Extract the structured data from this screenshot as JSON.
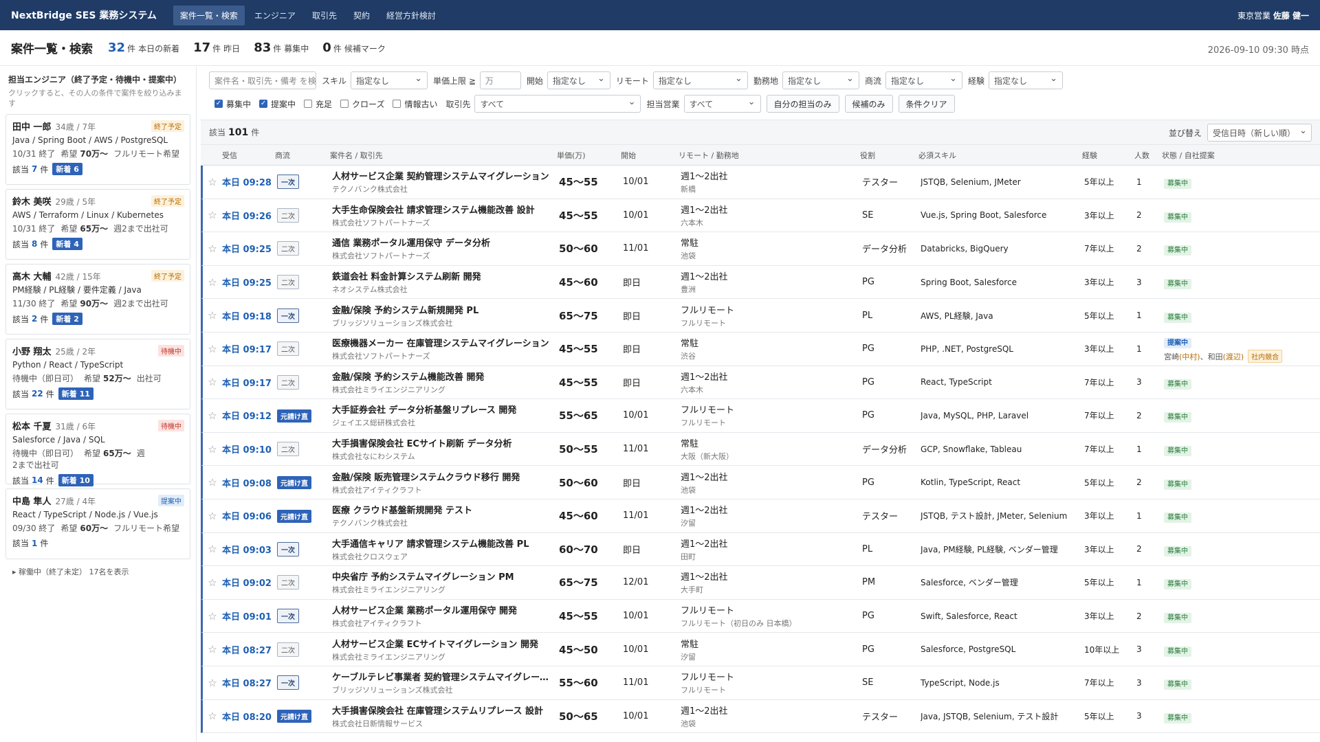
{
  "app": {
    "brand": "NextBridge SES 業務システム",
    "user_dept": "東京営業",
    "user_name": "佐藤 健一"
  },
  "nav": [
    {
      "label": "案件一覧・検索",
      "active": true
    },
    {
      "label": "エンジニア",
      "active": false
    },
    {
      "label": "取引先",
      "active": false
    },
    {
      "label": "契約",
      "active": false
    },
    {
      "label": "経営方針検討",
      "active": false
    }
  ],
  "header": {
    "title": "案件一覧・検索",
    "stats": [
      {
        "num": "32",
        "unit": "件",
        "label": "本日の新着",
        "color": "blue"
      },
      {
        "num": "17",
        "unit": "件",
        "label": "昨日",
        "color": "dark"
      },
      {
        "num": "83",
        "unit": "件",
        "label": "募集中",
        "color": "dark"
      },
      {
        "num": "0",
        "unit": "件",
        "label": "候補マーク",
        "color": "dark"
      }
    ],
    "timestamp": "2026-09-10 09:30 時点"
  },
  "sidebar": {
    "title": "担当エンジニア（終了予定・待機中・提案中）",
    "desc": "クリックすると、その人の条件で案件を絞り込みます",
    "match_label": "該当",
    "match_unit": "件",
    "engineers": [
      {
        "name": "田中 一郎",
        "meta": "34歳 / 7年",
        "status": "終了予定",
        "status_type": "end",
        "skills": "Java / Spring Boot / AWS / PostgreSQL",
        "avail": "10/31 終了",
        "wish_label": "希望",
        "wish": "70万〜",
        "remote": "フルリモート希望",
        "count": "7",
        "new": "新着 6"
      },
      {
        "name": "鈴木 美咲",
        "meta": "29歳 / 5年",
        "status": "終了予定",
        "status_type": "end",
        "skills": "AWS / Terraform / Linux / Kubernetes",
        "avail": "10/31 終了",
        "wish_label": "希望",
        "wish": "65万〜",
        "remote": "週2まで出社可",
        "count": "8",
        "new": "新着 4"
      },
      {
        "name": "高木 大輔",
        "meta": "42歳 / 15年",
        "status": "終了予定",
        "status_type": "end",
        "skills": "PM経験 / PL経験 / 要件定義 / Java",
        "avail": "11/30 終了",
        "wish_label": "希望",
        "wish": "90万〜",
        "remote": "週2まで出社可",
        "count": "2",
        "new": "新着 2"
      },
      {
        "name": "小野 翔太",
        "meta": "25歳 / 2年",
        "status": "待機中",
        "status_type": "wait",
        "skills": "Python / React / TypeScript",
        "avail": "待機中（即日可）",
        "wish_label": "希望",
        "wish": "52万〜",
        "remote": "出社可",
        "count": "22",
        "new": "新着 11"
      },
      {
        "name": "松本 千夏",
        "meta": "31歳 / 6年",
        "status": "待機中",
        "status_type": "wait",
        "skills": "Salesforce / Java / SQL",
        "avail": "待機中（即日可）",
        "wish_label": "希望",
        "wish": "65万〜",
        "remote": "週2まで出社可",
        "count": "14",
        "new": "新着 10"
      },
      {
        "name": "中島 隼人",
        "meta": "27歳 / 4年",
        "status": "提案中",
        "status_type": "prop",
        "skills": "React / TypeScript / Node.js / Vue.js",
        "avail": "09/30 終了",
        "wish_label": "希望",
        "wish": "60万〜",
        "remote": "フルリモート希望",
        "count": "1",
        "new": ""
      }
    ],
    "footer": "▸ 稼働中（終了未定） 17名を表示"
  },
  "filters": {
    "search_placeholder": "案件名・取引先・備考 を検索",
    "skill_label": "スキル",
    "skill_value": "指定なし",
    "price_label": "単価上限 ≧",
    "price_value": "万",
    "start_label": "開始",
    "start_value": "指定なし",
    "remote_label": "リモート",
    "remote_value": "指定なし",
    "location_label": "勤務地",
    "location_value": "指定なし",
    "flow_label": "商流",
    "flow_value": "指定なし",
    "exp_label": "経験",
    "exp_value": "指定なし",
    "checks": [
      {
        "label": "募集中",
        "checked": true
      },
      {
        "label": "提案中",
        "checked": true
      },
      {
        "label": "充足",
        "checked": false
      },
      {
        "label": "クローズ",
        "checked": false
      },
      {
        "label": "情報古い",
        "checked": false
      }
    ],
    "client_label": "取引先",
    "client_value": "すべて",
    "sales_label": "担当営業",
    "sales_value": "すべて",
    "btn_mine": "自分の担当のみ",
    "btn_candidate": "候補のみ",
    "btn_clear": "条件クリア"
  },
  "results": {
    "label": "該当",
    "count": "101",
    "unit": "件",
    "sort_label": "並び替え",
    "sort_value": "受信日時（新しい順）"
  },
  "table": {
    "headers": [
      "受信",
      "商流",
      "案件名 / 取引先",
      "単価(万)",
      "開始",
      "リモート / 勤務地",
      "役割",
      "必須スキル",
      "経験",
      "人数",
      "状態 / 自社提案"
    ],
    "rows": [
      {
        "time": "本日 09:28",
        "flow": "一次",
        "flow_type": "1",
        "title": "人材サービス企業 契約管理システムマイグレーション",
        "company": "テクノバンク株式会社",
        "price": "45〜55",
        "start": "10/01",
        "remote": "週1〜2出社",
        "loc": "新橋",
        "role": "テスター",
        "skills": "JSTQB, Selenium, JMeter",
        "exp": "5年以上",
        "num": "1",
        "status": "募集中"
      },
      {
        "time": "本日 09:26",
        "flow": "二次",
        "flow_type": "2",
        "title": "大手生命保険会社 請求管理システム機能改善 設計",
        "company": "株式会社ソフトパートナーズ",
        "price": "45〜55",
        "start": "10/01",
        "remote": "週1〜2出社",
        "loc": "六本木",
        "role": "SE",
        "skills": "Vue.js, Spring Boot, Salesforce",
        "exp": "3年以上",
        "num": "2",
        "status": "募集中"
      },
      {
        "time": "本日 09:25",
        "flow": "二次",
        "flow_type": "2",
        "title": "通信 業務ポータル運用保守 データ分析",
        "company": "株式会社ソフトパートナーズ",
        "price": "50〜60",
        "start": "11/01",
        "remote": "常駐",
        "loc": "池袋",
        "role": "データ分析",
        "skills": "Databricks, BigQuery",
        "exp": "7年以上",
        "num": "2",
        "status": "募集中"
      },
      {
        "time": "本日 09:25",
        "flow": "二次",
        "flow_type": "2",
        "title": "鉄道会社 料金計算システム刷新 開発",
        "company": "ネオシステム株式会社",
        "price": "45〜60",
        "start": "即日",
        "remote": "週1〜2出社",
        "loc": "豊洲",
        "role": "PG",
        "skills": "Spring Boot, Salesforce",
        "exp": "3年以上",
        "num": "3",
        "status": "募集中"
      },
      {
        "time": "本日 09:18",
        "flow": "一次",
        "flow_type": "1",
        "title": "金融/保険 予約システム新規開発 PL",
        "company": "ブリッジソリューションズ株式会社",
        "price": "65〜75",
        "start": "即日",
        "remote": "フルリモート",
        "loc": "フルリモート",
        "role": "PL",
        "skills": "AWS, PL経験, Java",
        "exp": "5年以上",
        "num": "1",
        "status": "募集中"
      },
      {
        "time": "本日 09:17",
        "flow": "二次",
        "flow_type": "2",
        "title": "医療機器メーカー 在庫管理システムマイグレーション",
        "company": "株式会社ソフトパートナーズ",
        "price": "45〜55",
        "start": "即日",
        "remote": "常駐",
        "loc": "渋谷",
        "role": "PG",
        "skills": "PHP, .NET, PostgreSQL",
        "exp": "3年以上",
        "num": "1",
        "status": "提案中",
        "proposal": true,
        "p1": "宮崎",
        "p1o": "(中村)",
        "p2": "、和田",
        "p2o": "(渡辺)",
        "conflict": "社内競合"
      },
      {
        "time": "本日 09:17",
        "flow": "二次",
        "flow_type": "2",
        "title": "金融/保険 予約システム機能改善 開発",
        "company": "株式会社ミライエンジニアリング",
        "price": "45〜55",
        "start": "即日",
        "remote": "週1〜2出社",
        "loc": "六本木",
        "role": "PG",
        "skills": "React, TypeScript",
        "exp": "7年以上",
        "num": "3",
        "status": "募集中"
      },
      {
        "time": "本日 09:12",
        "flow": "元請け直",
        "flow_type": "direct",
        "title": "大手証券会社 データ分析基盤リプレース 開発",
        "company": "ジェイエス総研株式会社",
        "price": "55〜65",
        "start": "10/01",
        "remote": "フルリモート",
        "loc": "フルリモート",
        "role": "PG",
        "skills": "Java, MySQL, PHP, Laravel",
        "exp": "7年以上",
        "num": "2",
        "status": "募集中"
      },
      {
        "time": "本日 09:10",
        "flow": "二次",
        "flow_type": "2",
        "title": "大手損害保険会社 ECサイト刷新 データ分析",
        "company": "株式会社なにわシステム",
        "price": "50〜55",
        "start": "11/01",
        "remote": "常駐",
        "loc": "大阪（新大阪）",
        "role": "データ分析",
        "skills": "GCP, Snowflake, Tableau",
        "exp": "7年以上",
        "num": "1",
        "status": "募集中"
      },
      {
        "time": "本日 09:08",
        "flow": "元請け直",
        "flow_type": "direct",
        "title": "金融/保険 販売管理システムクラウド移行 開発",
        "company": "株式会社アイティクラフト",
        "price": "50〜60",
        "start": "即日",
        "remote": "週1〜2出社",
        "loc": "池袋",
        "role": "PG",
        "skills": "Kotlin, TypeScript, React",
        "exp": "5年以上",
        "num": "2",
        "status": "募集中"
      },
      {
        "time": "本日 09:06",
        "flow": "元請け直",
        "flow_type": "direct",
        "title": "医療 クラウド基盤新規開発 テスト",
        "company": "テクノバンク株式会社",
        "price": "45〜60",
        "start": "11/01",
        "remote": "週1〜2出社",
        "loc": "汐留",
        "role": "テスター",
        "skills": "JSTQB, テスト設計, JMeter, Selenium",
        "exp": "3年以上",
        "num": "1",
        "status": "募集中"
      },
      {
        "time": "本日 09:03",
        "flow": "一次",
        "flow_type": "1",
        "title": "大手通信キャリア 請求管理システム機能改善 PL",
        "company": "株式会社クロスウェア",
        "price": "60〜70",
        "start": "即日",
        "remote": "週1〜2出社",
        "loc": "田町",
        "role": "PL",
        "skills": "Java, PM経験, PL経験, ベンダー管理",
        "exp": "3年以上",
        "num": "2",
        "status": "募集中"
      },
      {
        "time": "本日 09:02",
        "flow": "二次",
        "flow_type": "2",
        "title": "中央省庁 予約システムマイグレーション PM",
        "company": "株式会社ミライエンジニアリング",
        "price": "65〜75",
        "start": "12/01",
        "remote": "週1〜2出社",
        "loc": "大手町",
        "role": "PM",
        "skills": "Salesforce, ベンダー管理",
        "exp": "5年以上",
        "num": "1",
        "status": "募集中"
      },
      {
        "time": "本日 09:01",
        "flow": "一次",
        "flow_type": "1",
        "title": "人材サービス企業 業務ポータル運用保守 開発",
        "company": "株式会社アイティクラフト",
        "price": "45〜55",
        "start": "10/01",
        "remote": "フルリモート",
        "loc": "フルリモート（初日のみ 日本橋）",
        "role": "PG",
        "skills": "Swift, Salesforce, React",
        "exp": "3年以上",
        "num": "2",
        "status": "募集中"
      },
      {
        "time": "本日 08:27",
        "flow": "二次",
        "flow_type": "2",
        "title": "人材サービス企業 ECサイトマイグレーション 開発",
        "company": "株式会社ミライエンジニアリング",
        "price": "45〜50",
        "start": "10/01",
        "remote": "常駐",
        "loc": "汐留",
        "role": "PG",
        "skills": "Salesforce, PostgreSQL",
        "exp": "10年以上",
        "num": "3",
        "status": "募集中"
      },
      {
        "time": "本日 08:27",
        "flow": "一次",
        "flow_type": "1",
        "title": "ケーブルテレビ事業者 契約管理システムマイグレーション",
        "company": "ブリッジソリューションズ株式会社",
        "price": "55〜60",
        "start": "11/01",
        "remote": "フルリモート",
        "loc": "フルリモート",
        "role": "SE",
        "skills": "TypeScript, Node.js",
        "exp": "7年以上",
        "num": "3",
        "status": "募集中"
      },
      {
        "time": "本日 08:20",
        "flow": "元請け直",
        "flow_type": "direct",
        "title": "大手損害保険会社 在庫管理システムリプレース 設計",
        "company": "株式会社日新情報サービス",
        "price": "50〜65",
        "start": "10/01",
        "remote": "週1〜2出社",
        "loc": "池袋",
        "role": "テスター",
        "skills": "Java, JSTQB, Selenium, テスト設計",
        "exp": "5年以上",
        "num": "3",
        "status": "募集中"
      }
    ]
  }
}
